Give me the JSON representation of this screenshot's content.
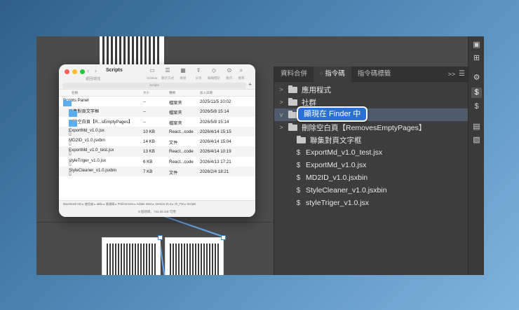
{
  "finder": {
    "title": "Scripts",
    "nav_label": "返回/前往",
    "toolbar": [
      {
        "icon": "sidebar-icon",
        "glyph": "▭",
        "label": "Sidebar"
      },
      {
        "icon": "list-view-icon",
        "glyph": "☰",
        "label": "顯示方式"
      },
      {
        "icon": "group-icon",
        "glyph": "▦",
        "label": "群組"
      },
      {
        "icon": "share-icon",
        "glyph": "⇪",
        "label": "分享"
      },
      {
        "icon": "tag-icon",
        "glyph": "◇",
        "label": "編輯標記"
      },
      {
        "icon": "more-icon",
        "glyph": "⊙",
        "label": "動作"
      },
      {
        "icon": "search-icon",
        "glyph": "⌕",
        "label": "搜尋"
      }
    ],
    "search_placeholder": "Scripts",
    "columns": {
      "name": "名稱",
      "size": "大小",
      "kind": "種類",
      "date": "加入日期"
    },
    "rows": [
      {
        "name": "Scripts Panel",
        "size": "--",
        "kind": "檔案夾",
        "date": "2025/11/5 10:02",
        "icon": "folder",
        "expanded": true,
        "indent": 0
      },
      {
        "name": "聯集對頁文字框",
        "size": "--",
        "kind": "檔案夾",
        "date": "2026/5/8 15:14",
        "icon": "folder",
        "indent": 1
      },
      {
        "name": "刪除空白頁【R...sEmptyPages】",
        "size": "--",
        "kind": "檔案夾",
        "date": "2026/5/8 15:14",
        "icon": "folder",
        "indent": 1
      },
      {
        "name": "ExportMd_v1.0.jsx",
        "size": "10 KB",
        "kind": "React...code",
        "date": "2026/4/14 15:15",
        "icon": "doc",
        "indent": 1
      },
      {
        "name": "MD2ID_v1.0.jsxbin",
        "size": "14 KB",
        "kind": "文件",
        "date": "2026/4/14 15:04",
        "icon": "doc",
        "indent": 1
      },
      {
        "name": "ExportMd_v1.0_test.jsx",
        "size": "13 KB",
        "kind": "React...code",
        "date": "2026/4/14 10:19",
        "icon": "doc",
        "indent": 1
      },
      {
        "name": "styleTriger_v1.0.jsx",
        "size": "6 KB",
        "kind": "React...code",
        "date": "2026/4/13 17:21",
        "icon": "doc",
        "indent": 1
      },
      {
        "name": "StyleCleaner_v1.0.jsxbin",
        "size": "7 KB",
        "kind": "文件",
        "date": "2026/2/4 18:21",
        "icon": "doc",
        "indent": 1
      }
    ],
    "path": "Macintosh HD ▸ 使用者 ▸ akilu ▸ 資源庫 ▸ Preferences ▸ Adobe InDe ▸ Version 21.0 ▸ zh_TW ▸ Scripts",
    "status": "8 個項目，733.35 GB 可用"
  },
  "panel": {
    "tabs": [
      {
        "label": "資料合併",
        "active": false
      },
      {
        "label": "指令碼",
        "active": true
      },
      {
        "label": "指令碼標籤",
        "active": false
      }
    ],
    "more": ">>",
    "menu": "☰",
    "tree": [
      {
        "label": "應用程式",
        "type": "folder",
        "chevron": ">"
      },
      {
        "label": "社群",
        "type": "folder",
        "chevron": ">"
      },
      {
        "label": "使用者",
        "type": "folder",
        "chevron": "v",
        "selected": true
      },
      {
        "label": "刪除空白頁【RemovesEmptyPages】",
        "type": "folder",
        "chevron": ">"
      },
      {
        "label": "聯集對頁文字框",
        "type": "folder",
        "chevron": ""
      },
      {
        "label": "ExportMd_v1.0_test.jsx",
        "type": "script"
      },
      {
        "label": "ExportMd_v1.0.jsx",
        "type": "script"
      },
      {
        "label": "MD2ID_v1.0.jsxbin",
        "type": "script"
      },
      {
        "label": "StyleCleaner_v1.0.jsxbin",
        "type": "script"
      },
      {
        "label": "styleTriger_v1.0.jsx",
        "type": "script"
      }
    ],
    "tooltip": "顯現在 Finder 中"
  },
  "right_tools": [
    {
      "icon": "image-icon",
      "glyph": "▣"
    },
    {
      "icon": "add-frame-icon",
      "glyph": "⊞"
    },
    {
      "icon": "script-gear-icon",
      "glyph": "⚙"
    },
    {
      "icon": "script-icon",
      "glyph": "$",
      "active": true
    },
    {
      "icon": "script-label-icon",
      "glyph": "$"
    },
    {
      "icon": "align-icon",
      "glyph": "▤"
    },
    {
      "icon": "pathfinder-icon",
      "glyph": "▧"
    }
  ]
}
